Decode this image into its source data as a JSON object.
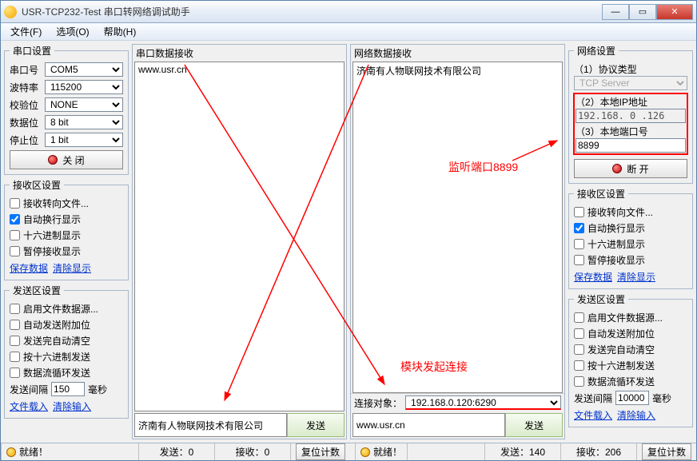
{
  "window": {
    "title": "USR-TCP232-Test 串口转网络调试助手"
  },
  "menu": {
    "file": "文件(F)",
    "options": "选项(O)",
    "help": "帮助(H)"
  },
  "serial": {
    "legend": "串口设置",
    "port_label": "串口号",
    "port": "COM5",
    "baud_label": "波特率",
    "baud": "115200",
    "parity_label": "校验位",
    "parity": "NONE",
    "data_label": "数据位",
    "data": "8 bit",
    "stop_label": "停止位",
    "stop": "1 bit",
    "close_btn": "关 闭"
  },
  "recvArea": {
    "legend": "接收区设置",
    "toFile": "接收转向文件...",
    "autoWrap": "自动换行显示",
    "hex": "十六进制显示",
    "pause": "暂停接收显示",
    "save": "保存数据",
    "clear": "清除显示"
  },
  "sendArea": {
    "legend": "发送区设置",
    "fileSrc": "启用文件数据源...",
    "autoExtra": "自动发送附加位",
    "autoClear": "发送完自动清空",
    "hexSend": "按十六进制发送",
    "loop": "数据流循环发送",
    "interval_label": "发送间隔",
    "ms": "毫秒",
    "fileLoad": "文件载入",
    "clearInput": "清除输入"
  },
  "sendIntervalLeft": "150",
  "sendIntervalRight": "10000",
  "midLeft": {
    "label": "串口数据接收",
    "text": "www.usr.cn",
    "sendText": "济南有人物联网技术有限公司",
    "sendBtn": "发送"
  },
  "midRight": {
    "label": "网络数据接收",
    "text": "济南有人物联网技术有限公司",
    "connLabel": "连接对象：",
    "connTarget": "192.168.0.120:6290",
    "sendText": "www.usr.cn",
    "sendBtn": "发送"
  },
  "net": {
    "legend": "网络设置",
    "proto_label": "（1）协议类型",
    "proto": "TCP Server",
    "ip_label": "（2）本地IP地址",
    "ip": "192.168. 0 .126",
    "port_label": "（3）本地端口号",
    "port": "8899",
    "disconnect_btn": "断 开"
  },
  "status": {
    "ready": "就绪！",
    "sendL": "发送：0",
    "recvL": "接收：0",
    "reset": "复位计数",
    "sendR": "发送：140",
    "recvR": "接收：206"
  },
  "annotations": {
    "listen": "监听端口8899",
    "moduleConn": "模块发起连接"
  }
}
